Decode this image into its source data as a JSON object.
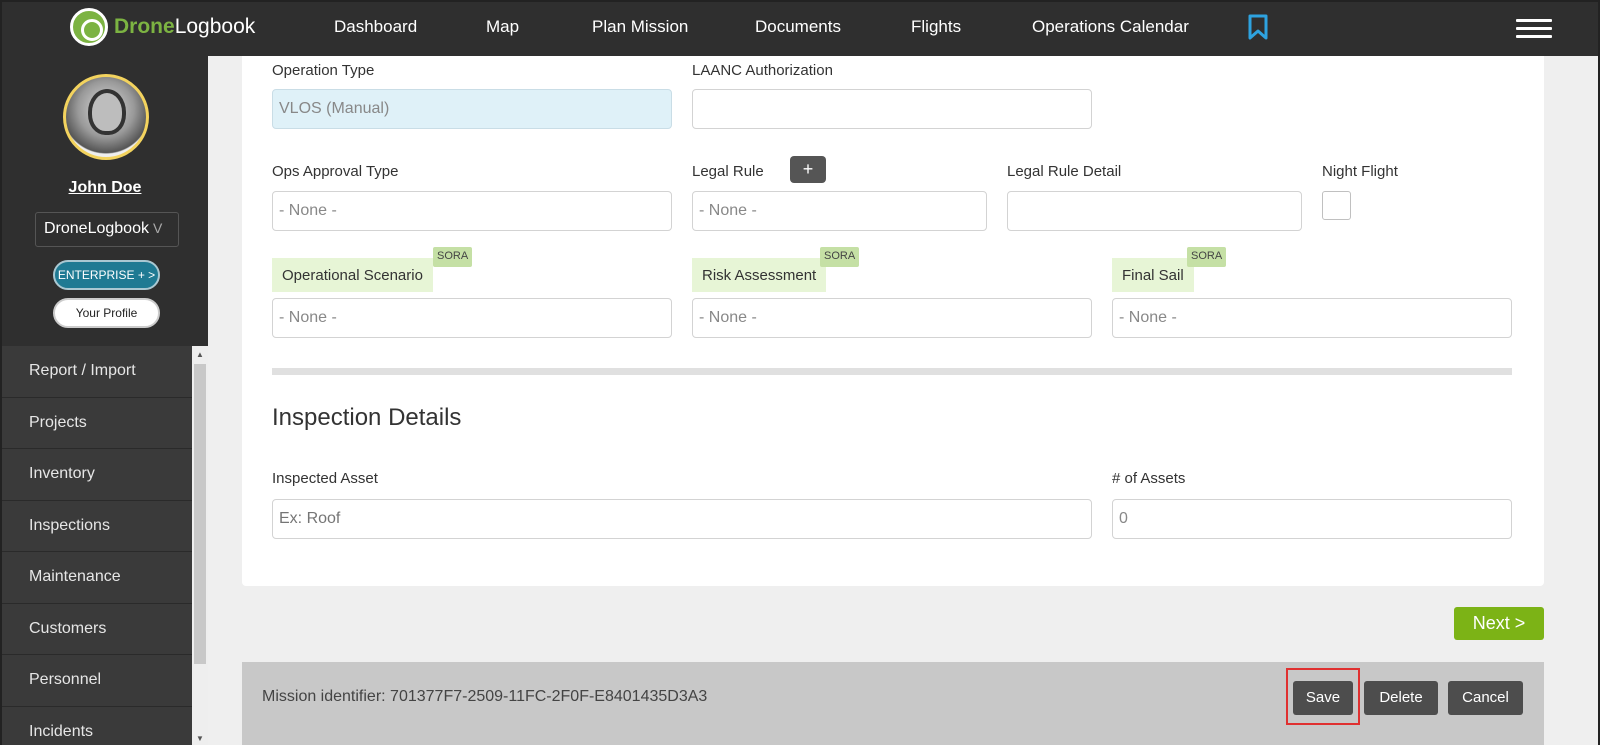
{
  "app": {
    "logo_primary": "Drone",
    "logo_secondary": "Logbook"
  },
  "nav": {
    "items": [
      "Dashboard",
      "Map",
      "Plan Mission",
      "Documents",
      "Flights",
      "Operations Calendar"
    ]
  },
  "user": {
    "name": "John Doe",
    "org": "DroneLogbook",
    "org_chevron": "V",
    "enterprise_label": "ENTERPRISE + >",
    "profile_label": "Your Profile"
  },
  "sidebar": {
    "items": [
      "Report / Import",
      "Projects",
      "Inventory",
      "Inspections",
      "Maintenance",
      "Customers",
      "Personnel",
      "Incidents"
    ]
  },
  "form": {
    "operation_type": {
      "label": "Operation Type",
      "value": "VLOS (Manual)"
    },
    "laanc": {
      "label": "LAANC Authorization",
      "value": ""
    },
    "ops_approval": {
      "label": "Ops Approval Type",
      "value": "- None -"
    },
    "legal_rule": {
      "label": "Legal Rule",
      "add": "+",
      "value": "- None -"
    },
    "legal_rule_detail": {
      "label": "Legal Rule Detail",
      "value": ""
    },
    "night_flight": {
      "label": "Night Flight",
      "checked": false
    },
    "operational_scenario": {
      "label": "Operational Scenario",
      "badge": "SORA",
      "value": "- None -"
    },
    "risk_assessment": {
      "label": "Risk Assessment",
      "badge": "SORA",
      "value": "- None -"
    },
    "final_sail": {
      "label": "Final Sail",
      "badge": "SORA",
      "value": "- None -"
    }
  },
  "inspection": {
    "title": "Inspection Details",
    "asset_label": "Inspected Asset",
    "asset_placeholder": "Ex: Roof",
    "count_label": "# of Assets",
    "count_value": "0"
  },
  "actions": {
    "next": "Next >",
    "mission_id": "Mission identifier: 701377F7-2509-11FC-2F0F-E8401435D3A3",
    "save": "Save",
    "delete": "Delete",
    "cancel": "Cancel"
  },
  "colors": {
    "accent_green": "#7cb316",
    "enterprise_blue": "#1f7a93",
    "bookmark_blue": "#2ea3e0",
    "highlight_red": "#e03030"
  }
}
